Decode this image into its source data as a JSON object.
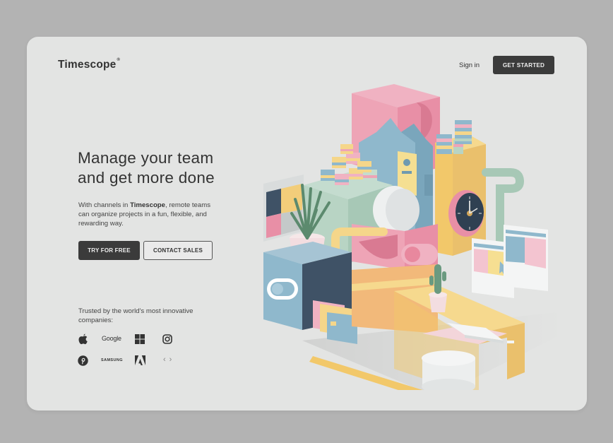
{
  "header": {
    "brand": "Timescope",
    "brand_mark": "®",
    "sign_in": "Sign in",
    "get_started": "GET STARTED"
  },
  "hero": {
    "headline_line1": "Manage your team",
    "headline_line2": "and get more done",
    "sub_prefix": "With channels in ",
    "sub_brand": "Timescope",
    "sub_suffix": ", remote teams can organize projects in a fun, flexible, and rewarding way.",
    "primary_cta": "TRY FOR FREE",
    "secondary_cta": "CONTACT SALES"
  },
  "trusted": {
    "label": "Trusted by the world's most innovative companies:",
    "logos": [
      {
        "name": "Apple",
        "icon": "apple-icon"
      },
      {
        "name": "Google",
        "icon": "google-wordmark"
      },
      {
        "name": "Microsoft",
        "icon": "windows-icon"
      },
      {
        "name": "Instagram",
        "icon": "instagram-icon"
      },
      {
        "name": "Pinterest",
        "icon": "pinterest-icon"
      },
      {
        "name": "SAMSUNG",
        "icon": "samsung-wordmark"
      },
      {
        "name": "Adobe",
        "icon": "adobe-icon"
      }
    ],
    "prev": "‹",
    "next": "›"
  },
  "colors": {
    "page_bg": "#b3b3b3",
    "card_bg": "#e3e4e3",
    "dark_button": "#3b3b3b",
    "text": "#333333",
    "pastel_pink": "#eea4b6",
    "pastel_blue": "#8fb8cc",
    "pastel_yellow": "#f2cd7a",
    "pastel_mint": "#b8d4c4",
    "navy": "#2f4052"
  }
}
